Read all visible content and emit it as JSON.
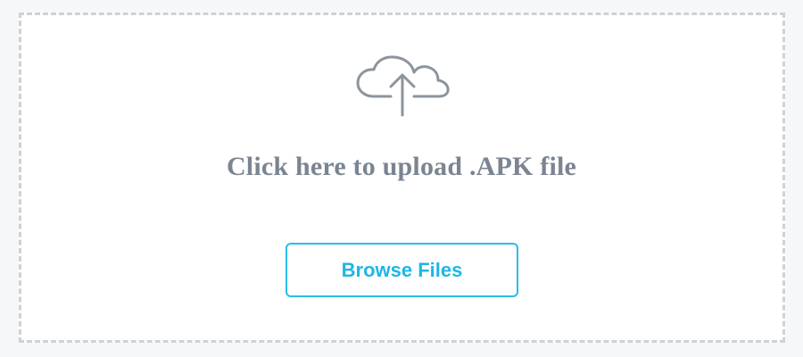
{
  "upload": {
    "icon": "cloud-upload-icon",
    "prompt": "Click here to upload .APK file",
    "browse_label": "Browse Files"
  },
  "colors": {
    "icon": "#8c949d",
    "prompt_text": "#7a8591",
    "button_accent": "#28bde8",
    "dashed_border": "#cfd1d4",
    "page_background": "#f6f7f9"
  }
}
